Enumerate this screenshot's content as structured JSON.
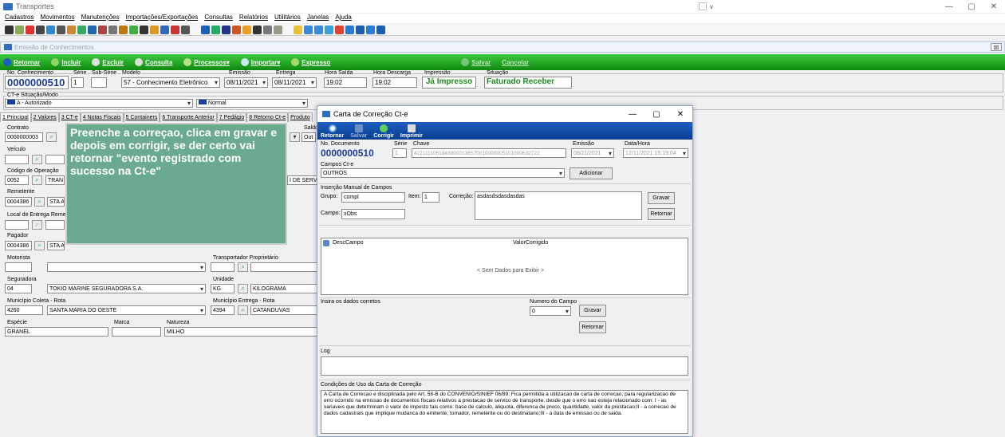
{
  "app": {
    "title": "Transportes"
  },
  "menu": [
    "Cadastros",
    "Movimentos",
    "Manutenções",
    "Importações/Exportações",
    "Consultas",
    "Relatórios",
    "Utilitários",
    "Janelas",
    "Ajuda"
  ],
  "child": {
    "title": "Emissão de Conhecimentos",
    "close": "⊠"
  },
  "actions": {
    "retornar": "Retornar",
    "incluir": "Incluir",
    "excluir": "Excluir",
    "consulta": "Consulta",
    "processos": "Processos",
    "importar": "Importar",
    "expresso": "Expresso",
    "salvar": "Salvar",
    "cancelar": "Cancelar"
  },
  "header": {
    "no_conhecimento_label": "No. Conhecimento",
    "no_conhecimento": "0000000510",
    "serie_label": "Série",
    "serie": "1",
    "subserie_label": "Sub-Série",
    "subserie": "",
    "modelo_label": "Modelo",
    "modelo": "57 - Conhecimento Eletrônico",
    "emissao_label": "Emissão",
    "emissao": "08/11/2021",
    "entrega_label": "Entrega",
    "entrega": "08/11/2021",
    "hora_saida_label": "Hora Saída",
    "hora_saida": "19:02",
    "hora_desc_label": "Hora Descarga",
    "hora_desc": "19:02",
    "impressao_label": "Impressão",
    "impressao": "Já Impresso",
    "situacao_label": "Situação",
    "situacao": "Faturado Receber",
    "cte_sit_label": "CT-e Situação/Modo",
    "cte_sit": "A - Autorizado",
    "cte_modo": "Normal"
  },
  "tabs": [
    "1 Principal",
    "2 Valores",
    "3 CT-e",
    "4 Notas Fiscais",
    "5 Containers",
    "6 Transporte Anterior",
    "7 Pedágio",
    "8 Retorno Ct-e",
    "Produto"
  ],
  "form": {
    "contrato_label": "Contrato",
    "contrato": "0000000003",
    "saldo_label": "Saldo",
    "saldo_val": "Out",
    "veiculo_label": "Veículo",
    "codop_label": "Código de Operação",
    "codop": "0052",
    "codop_desc": "TRAN",
    "codop_right": "I DE SERV",
    "remetente_label": "Remetente",
    "remetente": "0004386",
    "remetente_desc": "STA A",
    "local_entrega_label": "Local de Entrega Reme",
    "pagador_label": "Pagador",
    "pagador": "0004386",
    "pagador_desc": "STA A",
    "motorista_label": "Motorista",
    "transp_label": "Transportador Proprietário",
    "seguradora_label": "Seguradora",
    "seguradora": "04",
    "seguradora_desc": "TOKIO MARINE SEGURADORA S.A.",
    "unidade_label": "Unidade",
    "unidade": "KG",
    "unidade_desc": "KILOGRAMA",
    "mun_coleta_label": "Município Coleta - Rota",
    "mun_coleta": "4260",
    "mun_coleta_desc": "SANTA MARIA DO OESTE",
    "mun_entrega_label": "Município Entrega - Rota",
    "mun_entrega": "4394",
    "mun_entrega_desc": "CATANDUVAS",
    "especie_label": "Espécie",
    "especie": "GRANEL",
    "marca_label": "Marca",
    "marca": "",
    "natureza_label": "Natureza",
    "natureza": "MILHO"
  },
  "tooltip": "Preenche a correçao, clica em gravar e depois em corrigir, se der certo vai retornar \"evento registrado com sucesso na Ct-e\"",
  "dialog": {
    "title": "Carta de Correção Ct-e",
    "bar": {
      "retornar": "Retornar",
      "salvar": "Salvar",
      "corrigir": "Corrigir",
      "imprimir": "Imprimir"
    },
    "no_doc_label": "No. Documento",
    "no_doc": "0000000510",
    "serie_label": "Série",
    "serie": "1",
    "chave_label": "Chave",
    "chave": "42211110618439000136570010000005101000632722",
    "emissao_label": "Emissão",
    "emissao": "08/11/2021",
    "datahora_label": "Data/Hora",
    "datahora": "12/11/2021 15:19:04",
    "campos_label": "Campos Ct-e",
    "campos": "OUTROS",
    "adicionar": "Adicionar",
    "insercao_label": "Inserção Manual de Campos",
    "grupo_label": "Grupo:",
    "grupo": "compl",
    "item_label": "Item:",
    "item": "1",
    "correcao_label": "Correção:",
    "correcao": "asdasdsdasdasdas",
    "campo_label": "Campo:",
    "campo": "xObs",
    "gravar": "Gravar",
    "retornar": "Retornar",
    "grid_col1": "DescCampo",
    "grid_col2": "ValorCorrigido",
    "grid_empty": "< Sem Dados para Exibir >",
    "insira_label": "Insira os dados corretos",
    "numero_label": "Numero do Campo",
    "numero": "0",
    "log_label": "Log",
    "cond_label": "Condições de Uso da Carta de Correção",
    "cond_text": "A Carta de Correcao e disciplinada pelo Art. 58-B do CONVENIO/SINIEF 06/89: Fica permitida a utilizacao de carta de correcao, para regularizacao de erro ocorrido na emissao de documentos fiscais relativos a prestacao de servico de transporte, desde que o erro nao esteja relacionado com: I - as variaveis que determinam o valor do imposto tais como: base de calculo, aliquota, diferenca de preco, quantidade, valor da prestacao;II - a correcao de dados cadastrais que implique mudanca do emitente, tomador, remetente ou do destinatario;III - a data de emissao ou de saida."
  },
  "colors": {
    "green": "#1fa51f",
    "blue": "#1a3c9e",
    "tooltip": "#6aaa8e",
    "dlgbar": "#1c5fbe"
  }
}
